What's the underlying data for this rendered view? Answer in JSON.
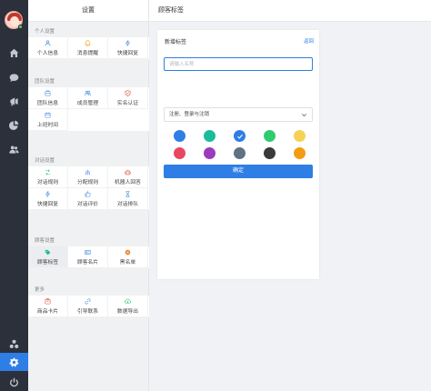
{
  "menu": {
    "title": "设置",
    "sections": [
      {
        "title": "个人设置",
        "items": [
          {
            "label": "个人信息",
            "icon": "user-icon",
            "color": "#4a90e2"
          },
          {
            "label": "消息提醒",
            "icon": "bell-icon",
            "color": "#f5a623"
          },
          {
            "label": "快捷回复",
            "icon": "bolt-icon",
            "color": "#4a90e2"
          }
        ]
      },
      {
        "title": "团队设置",
        "items": [
          {
            "label": "团队信息",
            "icon": "team-icon",
            "color": "#4a90e2"
          },
          {
            "label": "成员管理",
            "icon": "members-icon",
            "color": "#4a90e2"
          },
          {
            "label": "实名认证",
            "icon": "shield-icon",
            "color": "#e74c3c"
          },
          {
            "label": "上班时间",
            "icon": "calendar-icon",
            "color": "#4a90e2"
          }
        ]
      },
      {
        "title": "对话设置",
        "items": [
          {
            "label": "对话规则",
            "icon": "rules-icon",
            "color": "#2ecc71"
          },
          {
            "label": "分配规则",
            "icon": "distribute-icon",
            "color": "#4a90e2"
          },
          {
            "label": "机器人回答",
            "icon": "robot-icon",
            "color": "#e74c3c"
          },
          {
            "label": "快捷回复",
            "icon": "bolt-icon",
            "color": "#4a90e2"
          },
          {
            "label": "对话评价",
            "icon": "thumb-icon",
            "color": "#4a90e2"
          },
          {
            "label": "对话排队",
            "icon": "hourglass-icon",
            "color": "#4a90e2"
          }
        ]
      },
      {
        "title": "顾客设置",
        "items": [
          {
            "label": "顾客标签",
            "icon": "tag-icon",
            "color": "#1abc9c",
            "selected": true
          },
          {
            "label": "顾客名片",
            "icon": "card-icon",
            "color": "#4a90e2"
          },
          {
            "label": "黑名单",
            "icon": "block-icon",
            "color": "#e67e22"
          }
        ]
      },
      {
        "title": "更多",
        "items": [
          {
            "label": "商品卡片",
            "icon": "goods-icon",
            "color": "#e74c3c"
          },
          {
            "label": "引导联系",
            "icon": "link-icon",
            "color": "#4a90e2"
          },
          {
            "label": "数据导出",
            "icon": "export-icon",
            "color": "#2ecc71"
          }
        ]
      }
    ]
  },
  "main": {
    "title": "顾客标签",
    "card": {
      "title": "新增标签",
      "back": "返回",
      "input_placeholder": "请输入名称",
      "select_value": "注册、登录与注销",
      "confirm": "确定"
    },
    "colors": [
      "#2f7ee6",
      "#1abc9c",
      "#2f7ee6",
      "#2ecc71",
      "#f7d154",
      "#e8485f",
      "#9b3bbf",
      "#5f7282",
      "#3a3a3a",
      "#f39c12"
    ],
    "selected_color_index": 2
  },
  "rail": {
    "icons": [
      "home-icon",
      "chat-icon",
      "megaphone-icon",
      "pie-chart-icon",
      "contacts-icon",
      "apps-icon",
      "settings-icon",
      "power-icon"
    ],
    "active": "settings-icon"
  }
}
